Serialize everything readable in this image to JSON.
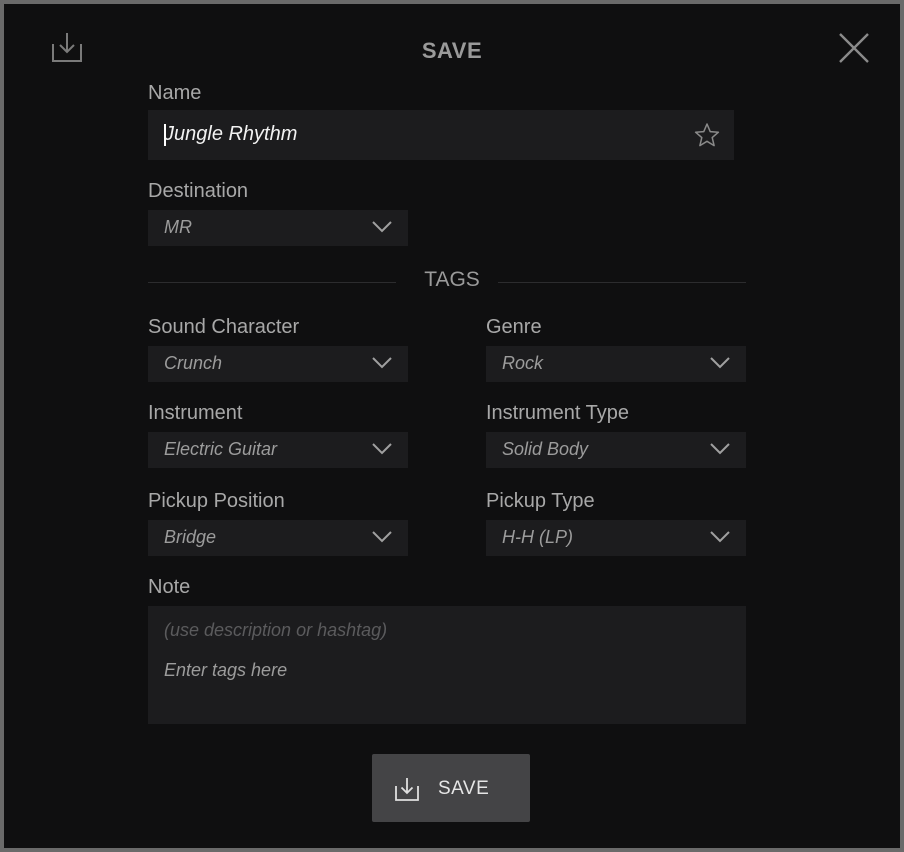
{
  "dialog": {
    "title": "SAVE",
    "close_icon": "close-icon",
    "header_icon": "download-tray-icon"
  },
  "name": {
    "label": "Name",
    "value": "Jungle Rhythm",
    "favorite_icon": "star-icon"
  },
  "destination": {
    "label": "Destination",
    "value": "MR"
  },
  "tags": {
    "title": "TAGS",
    "sound_character": {
      "label": "Sound Character",
      "value": "Crunch"
    },
    "genre": {
      "label": "Genre",
      "value": "Rock"
    },
    "instrument": {
      "label": "Instrument",
      "value": "Electric Guitar"
    },
    "instrument_type": {
      "label": "Instrument Type",
      "value": "Solid Body"
    },
    "pickup_position": {
      "label": "Pickup Position",
      "value": "Bridge"
    },
    "pickup_type": {
      "label": "Pickup Type",
      "value": "H-H (LP)"
    }
  },
  "note": {
    "label": "Note",
    "placeholder": "(use description or hashtag)",
    "value": "Enter tags here"
  },
  "save_button": {
    "label": "SAVE",
    "icon": "download-tray-icon"
  },
  "colors": {
    "background": "#0f0f10",
    "field": "#1c1c1e",
    "button": "#444446",
    "text": "#a8a8a8"
  }
}
